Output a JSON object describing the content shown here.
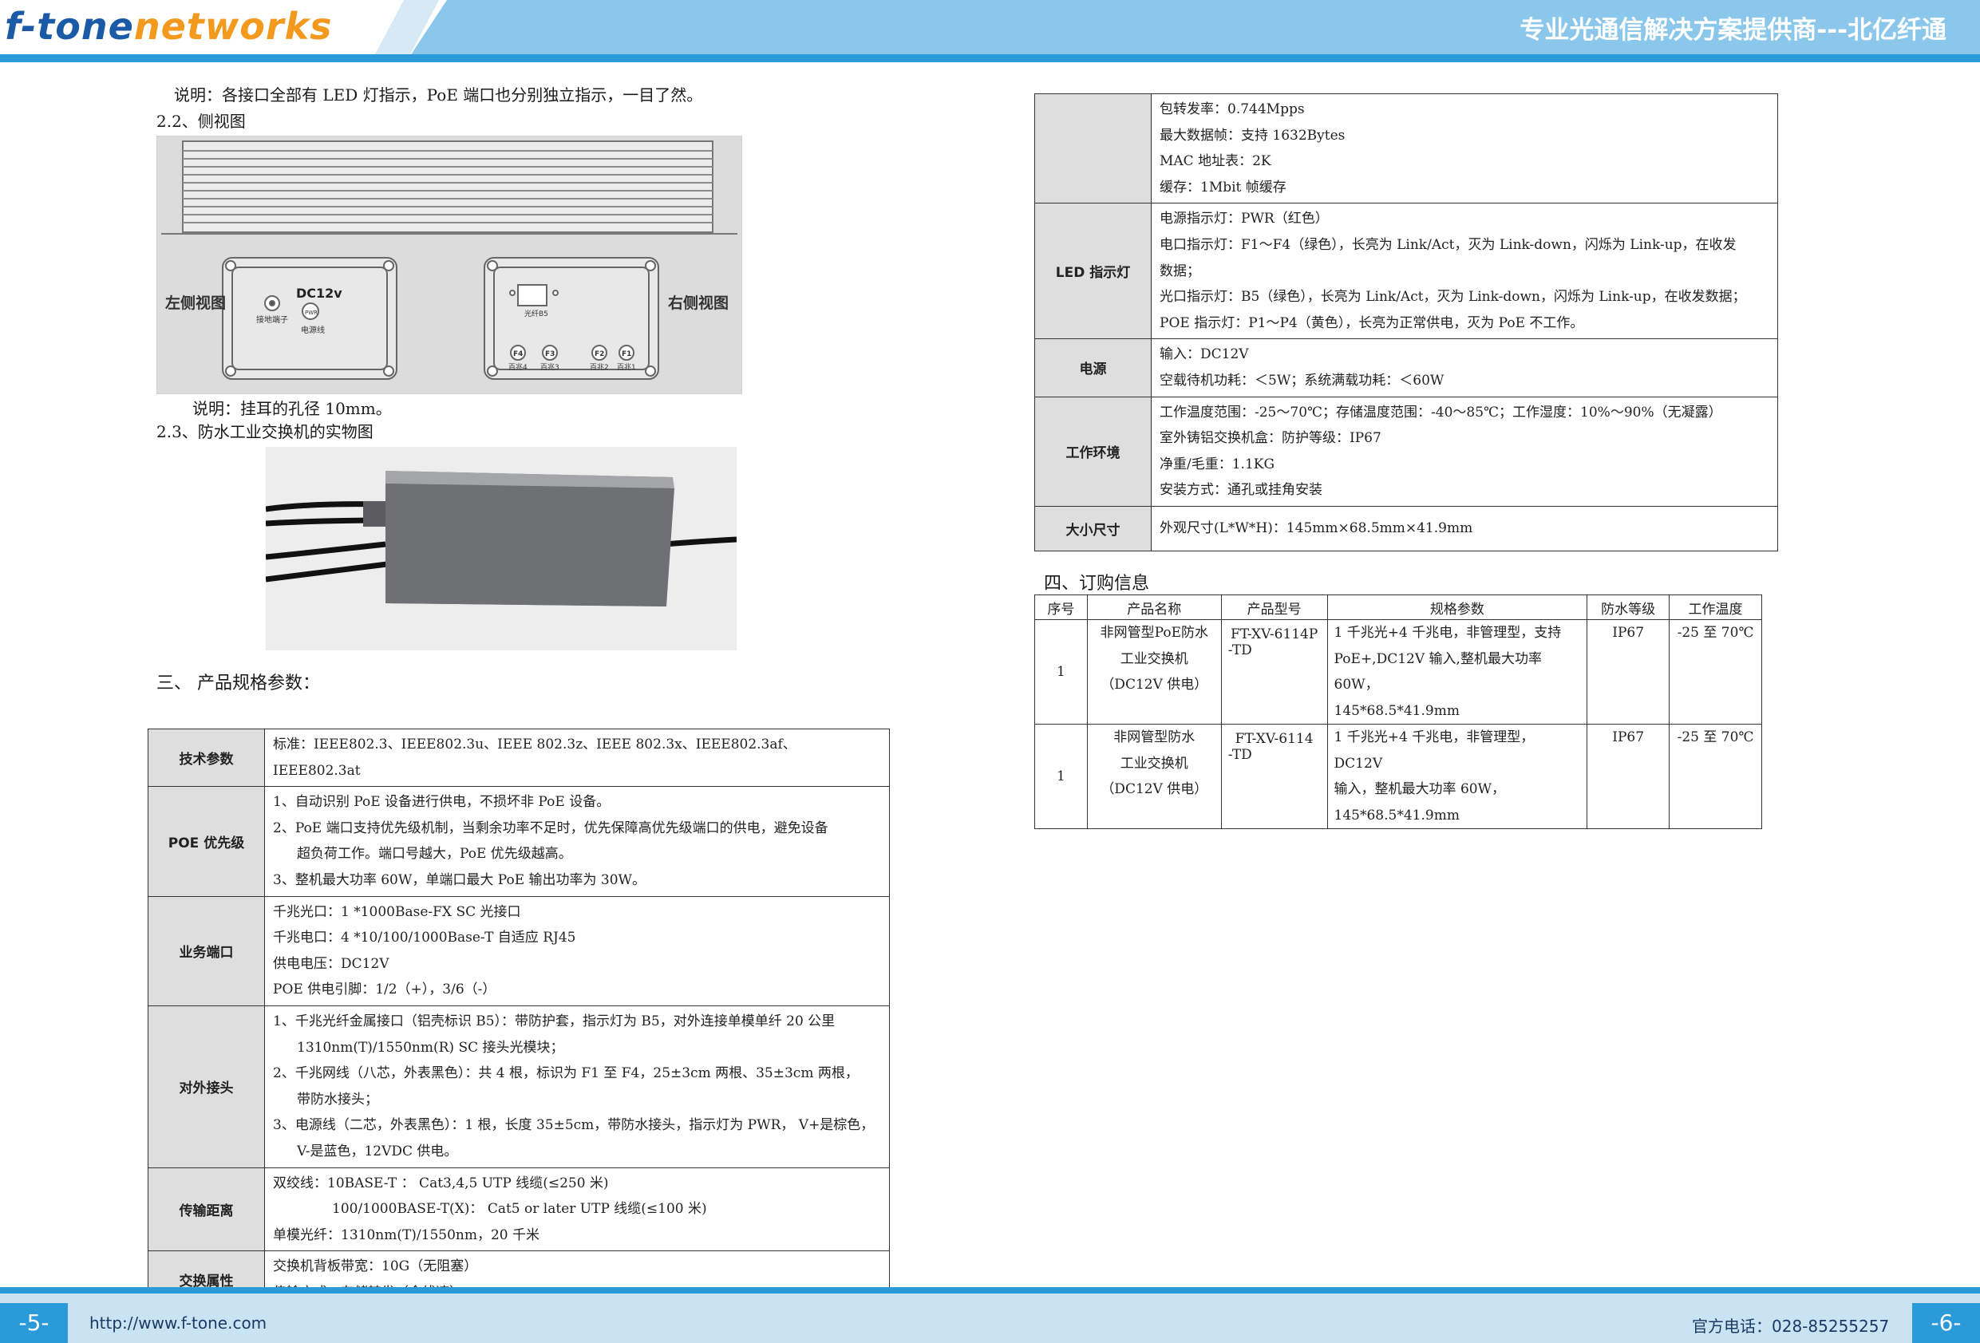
{
  "header": {
    "logo_part1": "f-tone",
    "logo_part2": "networks",
    "slogan": "专业光通信解决方案提供商---北亿纤通"
  },
  "footer": {
    "page_left": "-5-",
    "url": "http://www.f-tone.com",
    "phone": "官方电话：028-85255257",
    "page_right": "-6-"
  },
  "left": {
    "note1": "说明：各接口全部有 LED 灯指示，PoE 端口也分别独立指示，一目了然。",
    "section_22": "2.2、侧视图",
    "sideview": {
      "left_title": "左侧视图",
      "right_title": "右侧视图",
      "dc_label": "DC12v",
      "ground_label": "接地端子",
      "pwr_label": "PWR",
      "power_line_label": "电源线",
      "fiber_label": "光纤B5",
      "ports": [
        {
          "id": "F4",
          "label": "百兆4"
        },
        {
          "id": "F3",
          "label": "百兆3"
        },
        {
          "id": "F2",
          "label": "百兆2"
        },
        {
          "id": "F1",
          "label": "百兆1"
        }
      ]
    },
    "note2": "说明：挂耳的孔径 10mm。",
    "section_23": "2.3、防水工业交换机的实物图",
    "section_3": "三、 产品规格参数：",
    "spec_table": [
      {
        "key": "技术参数",
        "lines": [
          "标准：IEEE802.3、IEEE802.3u、IEEE 802.3z、IEEE 802.3x、IEEE802.3af、IEEE802.3at"
        ]
      },
      {
        "key": "POE 优先级",
        "lines": [
          "1、自动识别 PoE 设备进行供电，不损坏非 PoE 设备。",
          "2、PoE 端口支持优先级机制，当剩余功率不足时，优先保障高优先级端口的供电，避免设备",
          "超负荷工作。端口号越大，PoE 优先级越高。",
          "3、整机最大功率 60W，单端口最大 PoE 输出功率为 30W。"
        ]
      },
      {
        "key": "业务端口",
        "lines": [
          "千兆光口：1 *1000Base-FX SC 光接口",
          "千兆电口：4 *10/100/1000Base-T 自适应 RJ45",
          "供电电压：DC12V",
          "POE 供电引脚：1/2（+），3/6（-）"
        ]
      },
      {
        "key": "对外接头",
        "lines": [
          "1、千兆光纤金属接口（铝壳标识 B5）：带防护套，指示灯为 B5，对外连接单模单纤 20 公里",
          "1310nm(T)/1550nm(R) SC 接头光模块；",
          "2、千兆网线（八芯，外表黑色）：共 4 根，标识为 F1 至 F4，25±3cm 两根、35±3cm 两根，",
          "带防水接头；",
          "3、电源线（二芯，外表黑色）：1 根，长度 35±5cm，带防水接头，指示灯为 PWR，  V+是棕色，",
          "V-是蓝色，12VDC 供电。"
        ]
      },
      {
        "key": "传输距离",
        "lines": [
          "双绞线：10BASE-T ： Cat3,4,5 UTP 线缆(≤250 米)",
          "100/1000BASE-T(X)： Cat5 or later UTP 线缆(≤100 米)",
          "单模光纤：1310nm(T)/1550nm，20 千米"
        ]
      },
      {
        "key": "交换属性",
        "lines": [
          "交换机背板带宽：10G（无阻塞）",
          "传输方式：存储转发（全线速）"
        ]
      }
    ]
  },
  "right": {
    "spec_table": [
      {
        "key": "",
        "lines": [
          "包转发率：0.744Mpps",
          "最大数据帧：支持 1632Bytes",
          "MAC 地址表：2K",
          "缓存：1Mbit 帧缓存"
        ]
      },
      {
        "key": "LED 指示灯",
        "lines": [
          "电源指示灯：PWR（红色）",
          "电口指示灯：F1～F4（绿色），长亮为 Link/Act，灭为 Link-down，闪烁为 Link-up，在收发",
          "数据；",
          "光口指示灯：B5（绿色），长亮为 Link/Act，灭为 Link-down，闪烁为 Link-up，在收发数据；",
          "POE 指示灯：P1～P4（黄色），长亮为正常供电，灭为 PoE 不工作。"
        ]
      },
      {
        "key": "电源",
        "lines": [
          "输入：DC12V",
          "空载待机功耗：＜5W；系统满载功耗：＜60W"
        ]
      },
      {
        "key": "工作环境",
        "lines": [
          "工作温度范围：-25～70℃；存储温度范围：-40～85℃；工作湿度：10%～90%（无凝露）",
          "室外铸铝交换机盒：防护等级：IP67",
          "净重/毛重：1.1KG",
          "安装方式：通孔或挂角安装"
        ]
      },
      {
        "key": "大小尺寸",
        "lines": [
          "外观尺寸(L*W*H)：145mm×68.5mm×41.9mm"
        ]
      }
    ],
    "section_4": "四、订购信息",
    "order_headers": [
      "序号",
      "产品名称",
      "产品型号",
      "规格参数",
      "防水等级",
      "工作温度"
    ],
    "order_rows": [
      {
        "no": "1",
        "name": [
          "非网管型PoE防水",
          "工业交换机",
          "（DC12V 供电）"
        ],
        "model": [
          "FT-XV-6114P",
          "-TD"
        ],
        "spec": [
          "1 千兆光+4 千兆电，非管理型，支持",
          "PoE+,DC12V 输入,整机最大功率 60W，",
          "145*68.5*41.9mm"
        ],
        "ip": "IP67",
        "temp": "-25 至 70℃"
      },
      {
        "no": "1",
        "name": [
          "非网管型防水",
          "工业交换机",
          "（DC12V 供电）"
        ],
        "model": [
          "FT-XV-6114",
          "-TD"
        ],
        "spec": [
          "1 千兆光+4 千兆电，非管理型，DC12V",
          "输入，整机最大功率 60W，",
          "145*68.5*41.9mm"
        ],
        "ip": "IP67",
        "temp": "-25 至 70℃"
      }
    ]
  }
}
